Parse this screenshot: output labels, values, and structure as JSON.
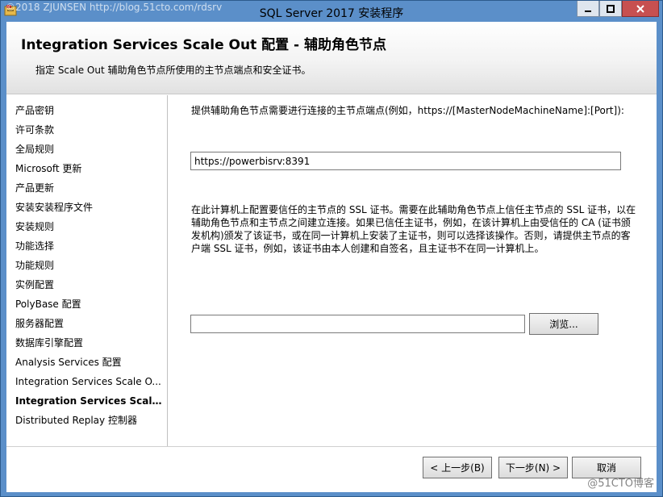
{
  "window": {
    "title": "SQL Server 2017 安装程序",
    "watermark_top": "©2018 ZJUNSEN http://blog.51cto.com/rdsrv",
    "watermark_bottom": "@51CTO博客"
  },
  "header": {
    "title": "Integration Services Scale Out 配置 - 辅助角色节点",
    "subtitle": "指定 Scale Out 辅助角色节点所使用的主节点端点和安全证书。"
  },
  "sidebar": {
    "items": [
      {
        "label": "产品密钥"
      },
      {
        "label": "许可条款"
      },
      {
        "label": "全局规则"
      },
      {
        "label": "Microsoft 更新"
      },
      {
        "label": "产品更新"
      },
      {
        "label": "安装安装程序文件"
      },
      {
        "label": "安装规则"
      },
      {
        "label": "功能选择"
      },
      {
        "label": "功能规则"
      },
      {
        "label": "实例配置"
      },
      {
        "label": "PolyBase 配置"
      },
      {
        "label": "服务器配置"
      },
      {
        "label": "数据库引擎配置"
      },
      {
        "label": "Analysis Services 配置"
      },
      {
        "label": "Integration Services Scale O..."
      },
      {
        "label": "Integration Services Scale ..."
      },
      {
        "label": "Distributed Replay 控制器"
      }
    ],
    "active_index": 15
  },
  "content": {
    "endpoint_prompt": "提供辅助角色节点需要进行连接的主节点端点(例如，https://[MasterNodeMachineName]:[Port]):",
    "endpoint_value": "https://powerbisrv:8391",
    "ssl_description": "在此计算机上配置要信任的主节点的 SSL 证书。需要在此辅助角色节点上信任主节点的 SSL 证书，以在辅助角色节点和主节点之间建立连接。如果已信任主证书，例如，在该计算机上由受信任的 CA (证书颁发机构)颁发了该证书，或在同一计算机上安装了主证书，则可以选择该操作。否则，请提供主节点的客户端 SSL 证书，例如，该证书由本人创建和自签名，且主证书不在同一计算机上。",
    "certificate_path_value": "",
    "browse_label": "浏览..."
  },
  "footer": {
    "back_label": "< 上一步(B)",
    "next_label": "下一步(N) >",
    "cancel_label": "取消"
  },
  "colors": {
    "frame": "#5b8fc9",
    "close_button": "#c75050"
  }
}
